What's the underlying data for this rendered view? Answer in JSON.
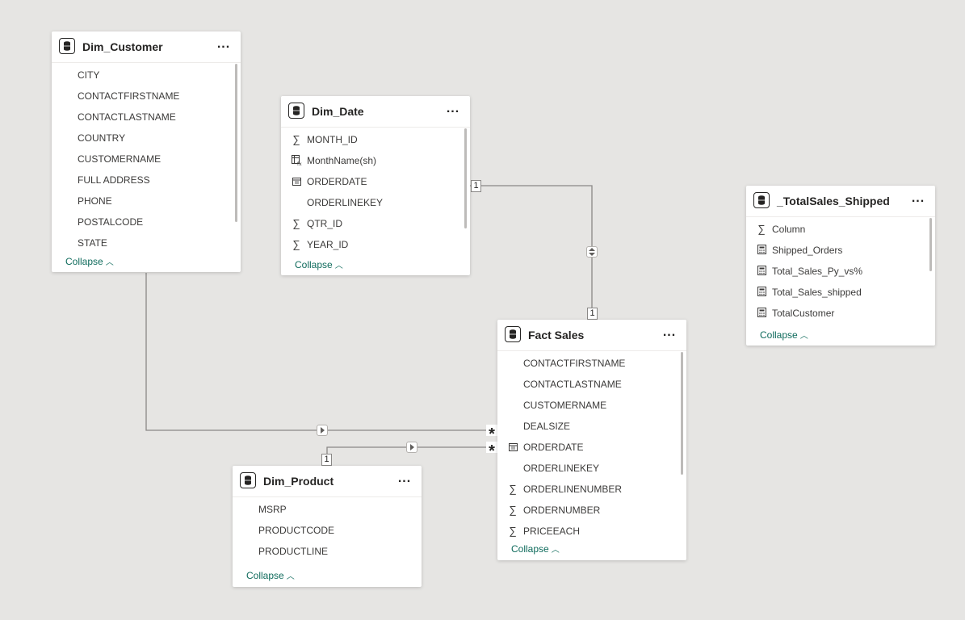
{
  "tables": {
    "dim_customer": {
      "title": "Dim_Customer",
      "more": "...",
      "fields": [
        {
          "name": "CITY",
          "icon": "none"
        },
        {
          "name": "CONTACTFIRSTNAME",
          "icon": "none"
        },
        {
          "name": "CONTACTLASTNAME",
          "icon": "none"
        },
        {
          "name": "COUNTRY",
          "icon": "none"
        },
        {
          "name": "CUSTOMERNAME",
          "icon": "none"
        },
        {
          "name": "FULL ADDRESS",
          "icon": "none"
        },
        {
          "name": "PHONE",
          "icon": "none"
        },
        {
          "name": "POSTALCODE",
          "icon": "none"
        },
        {
          "name": "STATE",
          "icon": "none"
        }
      ],
      "collapse_label": "Collapse"
    },
    "dim_date": {
      "title": "Dim_Date",
      "more": "...",
      "fields": [
        {
          "name": "MONTH_ID",
          "icon": "sigma-icon"
        },
        {
          "name": "MonthName(sh)",
          "icon": "calculated-column-icon"
        },
        {
          "name": "ORDERDATE",
          "icon": "calendar-icon"
        },
        {
          "name": "ORDERLINEKEY",
          "icon": "none"
        },
        {
          "name": "QTR_ID",
          "icon": "sigma-icon"
        },
        {
          "name": "YEAR_ID",
          "icon": "sigma-icon"
        }
      ],
      "collapse_label": "Collapse"
    },
    "total_sales_shipped": {
      "title": "_TotalSales_Shipped",
      "more": "...",
      "fields": [
        {
          "name": "Column",
          "icon": "sigma-icon"
        },
        {
          "name": "Shipped_Orders",
          "icon": "measure-icon"
        },
        {
          "name": "Total_Sales_Py_vs%",
          "icon": "measure-icon"
        },
        {
          "name": "Total_Sales_shipped",
          "icon": "measure-icon"
        },
        {
          "name": "TotalCustomer",
          "icon": "measure-icon"
        }
      ],
      "collapse_label": "Collapse"
    },
    "fact_sales": {
      "title": "Fact Sales",
      "more": "...",
      "fields": [
        {
          "name": "CONTACTFIRSTNAME",
          "icon": "none"
        },
        {
          "name": "CONTACTLASTNAME",
          "icon": "none"
        },
        {
          "name": "CUSTOMERNAME",
          "icon": "none"
        },
        {
          "name": "DEALSIZE",
          "icon": "none"
        },
        {
          "name": "ORDERDATE",
          "icon": "calendar-icon"
        },
        {
          "name": "ORDERLINEKEY",
          "icon": "none"
        },
        {
          "name": "ORDERLINENUMBER",
          "icon": "sigma-icon"
        },
        {
          "name": "ORDERNUMBER",
          "icon": "sigma-icon"
        },
        {
          "name": "PRICEEACH",
          "icon": "sigma-icon"
        }
      ],
      "collapse_label": "Collapse"
    },
    "dim_product": {
      "title": "Dim_Product",
      "more": "...",
      "fields": [
        {
          "name": "MSRP",
          "icon": "none"
        },
        {
          "name": "PRODUCTCODE",
          "icon": "none"
        },
        {
          "name": "PRODUCTLINE",
          "icon": "none"
        }
      ],
      "collapse_label": "Collapse"
    }
  },
  "relationships": {
    "date_to_sales": {
      "one_label": "1",
      "many_label": "1",
      "direction": "both"
    },
    "customer_to_sales": {
      "many_label": "*",
      "direction": "single"
    },
    "product_to_sales": {
      "one_label": "1",
      "many_label": "*",
      "direction": "single"
    }
  },
  "colors": {
    "canvas": "#e6e5e3",
    "link": "#0f6b5c",
    "line": "#8a8886"
  }
}
